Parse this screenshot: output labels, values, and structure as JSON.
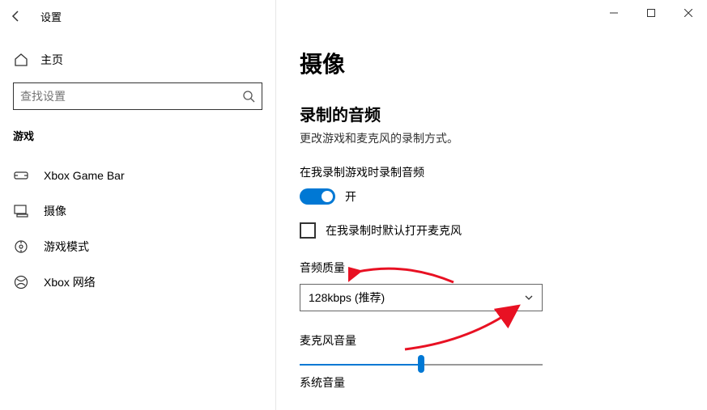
{
  "window": {
    "title": "设置"
  },
  "sidebar": {
    "home_label": "主页",
    "search_placeholder": "查找设置",
    "section_header": "游戏",
    "items": [
      {
        "label": "Xbox Game Bar"
      },
      {
        "label": "摄像"
      },
      {
        "label": "游戏模式"
      },
      {
        "label": "Xbox 网络"
      }
    ]
  },
  "content": {
    "page_title": "摄像",
    "audio_section_title": "录制的音频",
    "audio_section_desc": "更改游戏和麦克风的录制方式。",
    "record_audio_label": "在我录制游戏时录制音频",
    "toggle_state": "开",
    "mic_default_label": "在我录制时默认打开麦克风",
    "audio_quality_label": "音频质量",
    "audio_quality_value": "128kbps (推荐)",
    "mic_volume_label": "麦克风音量",
    "system_volume_label": "系统音量"
  },
  "annotations": {
    "color": "#E81123"
  }
}
